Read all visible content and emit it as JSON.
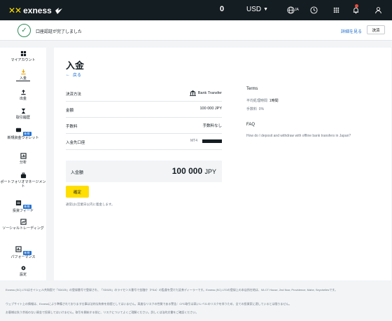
{
  "topbar": {
    "logo_text": "exness",
    "balance": "0",
    "currency": "USD",
    "lang": "JA"
  },
  "banner": {
    "text": "口座認証が完了しました",
    "link": "詳細を見る",
    "close": "決済"
  },
  "sidebar": {
    "items": [
      {
        "label": "マイアカウント"
      },
      {
        "label": "入金"
      },
      {
        "label": "出金"
      },
      {
        "label": "取引履歴"
      },
      {
        "label": "新規資金ウォレット",
        "badge": "新規"
      },
      {
        "label": "分析"
      },
      {
        "label": "ポートフォリオマネージメント"
      },
      {
        "label": "投資フィード",
        "badge": "新規"
      },
      {
        "label": "ソーシャルトレーディング"
      },
      {
        "label": "パフォーマンス",
        "badge": "新規"
      },
      {
        "label": "設定"
      }
    ]
  },
  "main": {
    "title": "入金",
    "back": "戻る",
    "rows": [
      {
        "label": "決済方法",
        "value": "Bank Transfer"
      },
      {
        "label": "金額",
        "value": "100 000 JPY"
      },
      {
        "label": "手数料",
        "value": "手数料なし"
      },
      {
        "label": "入金先口座",
        "value": "MT4"
      }
    ],
    "total_label": "入金額",
    "total_amount": "100 000",
    "total_unit": "JPY",
    "confirm": "確定",
    "note": "通常は1営業日以内に着金します。"
  },
  "terms": {
    "title": "Terms",
    "processing_label": "平均処理時間",
    "processing_value": "1時間",
    "fee_label": "手数料",
    "fee_value": "0%"
  },
  "faq": {
    "title": "FAQ",
    "link": "How do I deposit and withdraw with offline bank transfers in Japan?"
  },
  "footer": {
    "line1": "Exness (SC) LTDはセイシェル共和国で「SD025」の登録番号で登録され、「SD025」のライセンス番号で金融庁（FSA）の監督を受けた証券ディーラーです。Exness (SC) LTDの登録上の本店所在地は、9A CT House, 2nd floor, Providence, Mahe, Seychellesです。",
    "line2": "ウェブサイト上の情報は、Exnessにより準備されております仕事は法的な拘束を前提としてはいません。高度なリスクの性質である警告：CFD取引は高いレベルのリスクを伴うため、全ての投資家に適しているとは限りません。",
    "line3": "お客様は失う余裕のない資金で投資してはいけません。取引を開始する前に、リスクについてよくご理解ください。詳しくは法的文書をご確認ください。"
  }
}
